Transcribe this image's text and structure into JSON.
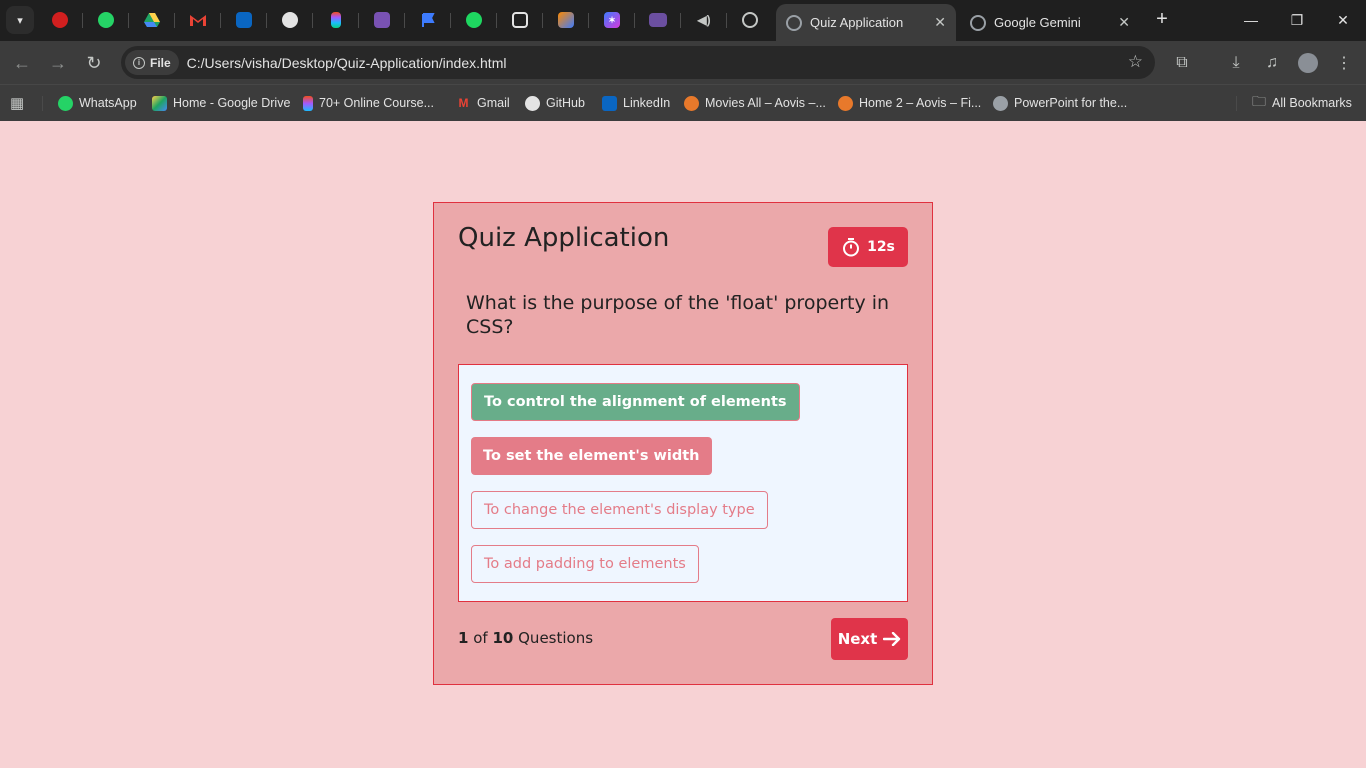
{
  "browser": {
    "tabs": [
      {
        "title": "Quiz Application",
        "active": true
      },
      {
        "title": "Google Gemini",
        "active": false
      }
    ],
    "new_tab": "+",
    "address": {
      "chip": "File",
      "url": "C:/Users/visha/Desktop/Quiz-Application/index.html"
    },
    "pinned_tabs": [
      "cricinfo-icon",
      "whatsapp-icon",
      "google-drive-icon",
      "gmail-icon",
      "linkedin-icon",
      "github-icon",
      "figma-icon",
      "bootstrap-icon",
      "flag-icon",
      "spotify-icon",
      "pocket-icon",
      "app-icon",
      "sparkle-icon",
      "coolors-icon",
      "speaker-icon",
      "chatgpt-icon"
    ],
    "bookmarks": [
      {
        "label": "WhatsApp",
        "icon": "whatsapp-icon"
      },
      {
        "label": "Home - Google Drive",
        "icon": "google-drive-icon"
      },
      {
        "label": "70+ Online Course...",
        "icon": "figma-icon"
      },
      {
        "label": "Gmail",
        "icon": "gmail-icon"
      },
      {
        "label": "GitHub",
        "icon": "github-icon"
      },
      {
        "label": "LinkedIn",
        "icon": "linkedin-icon"
      },
      {
        "label": "Movies All – Aovis –...",
        "icon": "reel-icon"
      },
      {
        "label": "Home 2 – Aovis – Fi...",
        "icon": "reel-icon"
      },
      {
        "label": "PowerPoint for the...",
        "icon": "globe-icon"
      }
    ],
    "all_bookmarks": "All Bookmarks"
  },
  "quiz": {
    "title": "Quiz Application",
    "timer": "12s",
    "question": "What is the purpose of the 'float' property in CSS?",
    "options": [
      {
        "text": "To control the alignment of elements",
        "state": "correct"
      },
      {
        "text": "To set the element's width",
        "state": "wrong"
      },
      {
        "text": "To change the element's display type",
        "state": "default"
      },
      {
        "text": "To add padding to elements",
        "state": "default"
      }
    ],
    "progress": {
      "current": "1",
      "of": "of",
      "total": "10",
      "label": "Questions"
    },
    "next_label": "Next"
  },
  "colors": {
    "page_bg": "#f7d2d4",
    "card_bg": "#eba8aa",
    "accent": "#e0344a",
    "correct": "#68ad8a",
    "wrong": "#e47c88"
  }
}
